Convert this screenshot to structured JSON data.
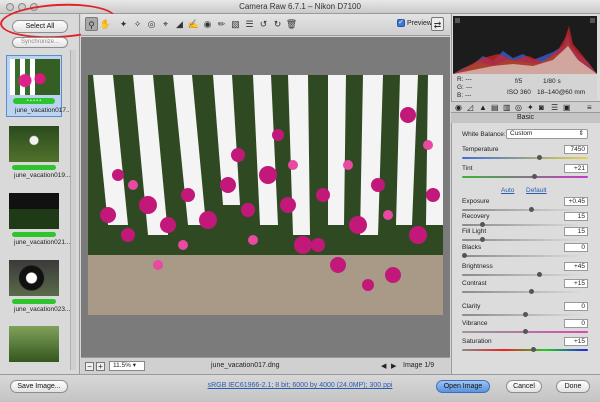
{
  "window": {
    "title": "Camera Raw 6.7.1  –  Nikon D7100"
  },
  "left_panel": {
    "select_all": "Select All",
    "synchronize": "Synchronize...",
    "thumbnails": [
      {
        "label": "june_vacation017....",
        "selected": true
      },
      {
        "label": "june_vacation019...."
      },
      {
        "label": "june_vacation021...."
      },
      {
        "label": "june_vacation023...."
      },
      {
        "label": ""
      }
    ]
  },
  "toolbar": {
    "tools": [
      "zoom-icon",
      "hand-icon",
      "white-balance-icon",
      "color-sampler-icon",
      "target-adjust-icon",
      "crop-icon",
      "straighten-icon",
      "spot-removal-icon",
      "red-eye-icon",
      "adjustment-brush-icon",
      "graduated-filter-icon",
      "preferences-icon",
      "rotate-left-icon",
      "rotate-right-icon",
      "trash-icon"
    ],
    "preview_label": "Preview"
  },
  "canvas": {
    "zoom": "11.5%",
    "filename": "june_vacation017.dng",
    "image_counter": "Image 1/9"
  },
  "readout": {
    "r_label": "R:",
    "g_label": "G:",
    "b_label": "B:",
    "r_value": "---",
    "g_value": "---",
    "b_value": "---",
    "aperture": "f/5",
    "shutter": "1/80 s",
    "iso": "ISO 360",
    "lens": "18–140@60 mm"
  },
  "basic": {
    "header": "Basic",
    "white_balance_label": "White Balance:",
    "white_balance_value": "Custom",
    "auto_label": "Auto",
    "default_label": "Default",
    "sliders": [
      {
        "label": "Temperature",
        "value": "7450",
        "pos": 0.62
      },
      {
        "label": "Tint",
        "value": "+21",
        "pos": 0.58
      },
      {
        "label": "Exposure",
        "value": "+0.45",
        "pos": 0.55
      },
      {
        "label": "Recovery",
        "value": "15",
        "pos": 0.15
      },
      {
        "label": "Fill Light",
        "value": "15",
        "pos": 0.15
      },
      {
        "label": "Blacks",
        "value": "0",
        "pos": 0.0
      },
      {
        "label": "Brightness",
        "value": "+45",
        "pos": 0.62
      },
      {
        "label": "Contrast",
        "value": "+15",
        "pos": 0.55
      },
      {
        "label": "Clarity",
        "value": "0",
        "pos": 0.5
      },
      {
        "label": "Vibrance",
        "value": "0",
        "pos": 0.5
      },
      {
        "label": "Saturation",
        "value": "+15",
        "pos": 0.57
      }
    ]
  },
  "bottom": {
    "save_image": "Save Image...",
    "workflow": "sRGB IEC61966-2.1; 8 bit; 6000 by 4000 (24.0MP); 300 ppi",
    "open_image": "Open Image",
    "cancel": "Cancel",
    "done": "Done"
  },
  "colors": {
    "accent": "#3b78d8",
    "highlight_oval": "#e0242c",
    "rating_bar": "#2ec42e"
  }
}
